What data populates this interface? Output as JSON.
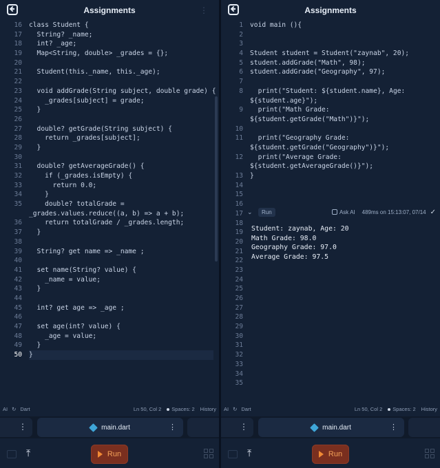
{
  "left_panel": {
    "title": "Assignments",
    "menu_glyph": "⋮",
    "lines": [
      {
        "n": "16",
        "code": "class Student {"
      },
      {
        "n": "17",
        "code": "  String? _name;"
      },
      {
        "n": "18",
        "code": "  int? _age;"
      },
      {
        "n": "19",
        "code": "  Map<String, double> _grades = {};"
      },
      {
        "n": "20",
        "code": ""
      },
      {
        "n": "21",
        "code": "  Student(this._name, this._age);"
      },
      {
        "n": "22",
        "code": ""
      },
      {
        "n": "23",
        "code": "  void addGrade(String subject, double grade) {"
      },
      {
        "n": "24",
        "code": "    _grades[subject] = grade;"
      },
      {
        "n": "25",
        "code": "  }"
      },
      {
        "n": "26",
        "code": ""
      },
      {
        "n": "27",
        "code": "  double? getGrade(String subject) {"
      },
      {
        "n": "28",
        "code": "    return _grades[subject];"
      },
      {
        "n": "29",
        "code": "  }"
      },
      {
        "n": "30",
        "code": ""
      },
      {
        "n": "31",
        "code": "  double? getAverageGrade() {"
      },
      {
        "n": "32",
        "code": "    if (_grades.isEmpty) {"
      },
      {
        "n": "33",
        "code": "      return 0.0;"
      },
      {
        "n": "34",
        "code": "    }"
      },
      {
        "n": "35",
        "code": "    double? totalGrade =\n_grades.values.reduce((a, b) => a + b);"
      },
      {
        "n": "36",
        "code": "    return totalGrade / _grades.length;"
      },
      {
        "n": "37",
        "code": "  }"
      },
      {
        "n": "38",
        "code": ""
      },
      {
        "n": "39",
        "code": "  String? get name => _name ;"
      },
      {
        "n": "40",
        "code": ""
      },
      {
        "n": "41",
        "code": "  set name(String? value) {"
      },
      {
        "n": "42",
        "code": "    _name = value;"
      },
      {
        "n": "43",
        "code": "  }"
      },
      {
        "n": "44",
        "code": ""
      },
      {
        "n": "45",
        "code": "  int? get age => _age ;"
      },
      {
        "n": "46",
        "code": ""
      },
      {
        "n": "47",
        "code": "  set age(int? value) {"
      },
      {
        "n": "48",
        "code": "    _age = value;"
      },
      {
        "n": "49",
        "code": "  }"
      },
      {
        "n": "50",
        "code": "}"
      }
    ],
    "status": {
      "ai": "AI",
      "lang": "Dart",
      "position": "Ln 50, Col 2",
      "spaces": "Spaces: 2",
      "history": "History"
    },
    "tab": {
      "file": "main.dart"
    },
    "run_label": "Run"
  },
  "right_panel": {
    "title": "Assignments",
    "lines": [
      {
        "n": "1",
        "code": "void main (){"
      },
      {
        "n": "2",
        "code": ""
      },
      {
        "n": "3",
        "code": ""
      },
      {
        "n": "4",
        "code": "Student student = Student(\"zaynab\", 20);"
      },
      {
        "n": "5",
        "code": "student.addGrade(\"Math\", 98);"
      },
      {
        "n": "6",
        "code": "student.addGrade(\"Geography\", 97);"
      },
      {
        "n": "7",
        "code": ""
      },
      {
        "n": "8",
        "code": "  print(\"Student: ${student.name}, Age:\n${student.age}\");"
      },
      {
        "n": "9",
        "code": "  print(\"Math Grade:\n${student.getGrade(\"Math\")}\");"
      },
      {
        "n": "10",
        "code": ""
      },
      {
        "n": "11",
        "code": "  print(\"Geography Grade:\n${student.getGrade(\"Geography\")}\");"
      },
      {
        "n": "12",
        "code": "  print(\"Average Grade:\n${student.getAverageGrade()}\");"
      },
      {
        "n": "13",
        "code": "}"
      },
      {
        "n": "14",
        "code": ""
      },
      {
        "n": "15",
        "code": ""
      },
      {
        "n": "16",
        "code": ""
      },
      {
        "n": "17",
        "code": ""
      },
      {
        "n": "18",
        "code": ""
      },
      {
        "n": "19",
        "code": ""
      },
      {
        "n": "20",
        "code": ""
      },
      {
        "n": "21",
        "code": ""
      },
      {
        "n": "22",
        "code": ""
      },
      {
        "n": "23",
        "code": ""
      },
      {
        "n": "24",
        "code": ""
      },
      {
        "n": "25",
        "code": ""
      },
      {
        "n": "26",
        "code": ""
      },
      {
        "n": "27",
        "code": ""
      },
      {
        "n": "28",
        "code": ""
      },
      {
        "n": "29",
        "code": ""
      },
      {
        "n": "30",
        "code": ""
      },
      {
        "n": "31",
        "code": ""
      },
      {
        "n": "32",
        "code": ""
      },
      {
        "n": "33",
        "code": ""
      },
      {
        "n": "34",
        "code": ""
      },
      {
        "n": "35",
        "code": ""
      }
    ],
    "run_bar": {
      "chip": "Run",
      "ask_ai": "Ask AI",
      "timing": "489ms on 15:13:07, 07/14"
    },
    "output": "Student: zaynab, Age: 20\nMath Grade: 98.0\nGeography Grade: 97.0\nAverage Grade: 97.5",
    "status": {
      "ai": "AI",
      "lang": "Dart",
      "position": "Ln 50, Col 2",
      "spaces": "Spaces: 2",
      "history": "History"
    },
    "tab": {
      "file": "main.dart"
    },
    "run_label": "Run"
  },
  "colors": {
    "accent_run": "#f08a35",
    "dart_blue": "#3fa6d8",
    "bg": "#142135"
  }
}
